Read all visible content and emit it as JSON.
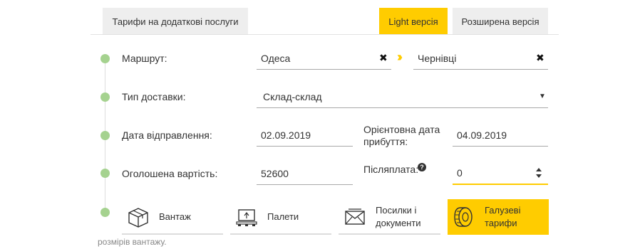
{
  "tabs": {
    "extra_services": "Тарифи на додаткові послуги",
    "light": "Light версія",
    "extended": "Розширена версія"
  },
  "form": {
    "route": {
      "label": "Маршрут:",
      "from": "Одеса",
      "to": "Чернівці",
      "clear_icon": "close-icon",
      "arrow_icon": "double-chevron-right-icon"
    },
    "delivery_type": {
      "label": "Тип доставки:",
      "value": "Склад-склад"
    },
    "send_date": {
      "label": "Дата відправлення:",
      "value": "02.09.2019"
    },
    "arrival_date": {
      "label": "Орієнтовна дата прибуття:",
      "value": "04.09.2019"
    },
    "declared_value": {
      "label": "Оголошена вартість:",
      "value": "52600"
    },
    "cod": {
      "label": "Післяплата:",
      "value": "0",
      "help_icon": "question-circle-icon"
    }
  },
  "cargo_types": [
    {
      "label": "Вантаж",
      "icon": "box-icon",
      "active": false
    },
    {
      "label": "Палети",
      "icon": "pallet-icon",
      "active": false
    },
    {
      "label": "Посилки і документи",
      "icon": "envelope-icon",
      "active": false
    },
    {
      "label": "Галузеві тарифи",
      "icon": "tire-icon",
      "active": true
    }
  ],
  "footer_partial_text": "розмірів вантажу.",
  "colors": {
    "accent": "#ffcc00",
    "timeline_dot": "#a5d28f",
    "tab_bg": "#eeeeee"
  }
}
